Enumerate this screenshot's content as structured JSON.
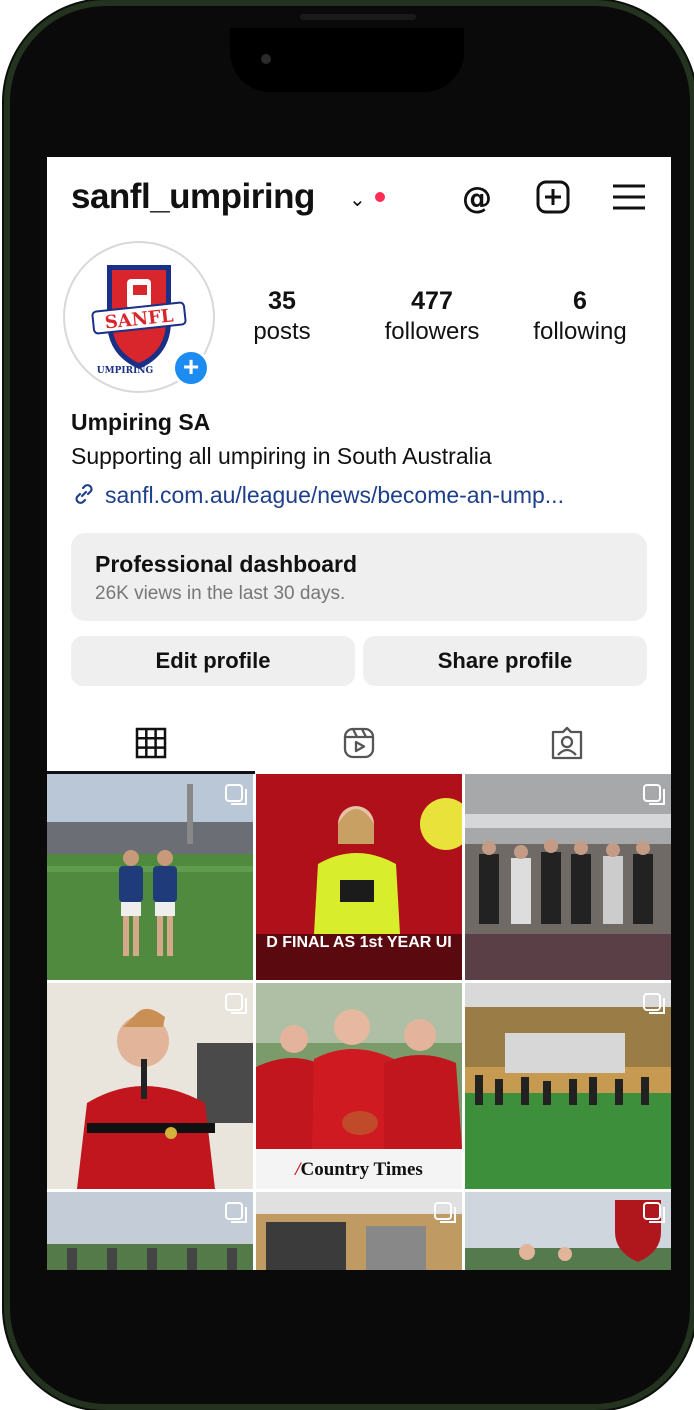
{
  "profile": {
    "username": "sanfl_umpiring",
    "display_name": "Umpiring SA",
    "bio": "Supporting all umpiring in South Australia",
    "link": "sanfl.com.au/league/news/become-an-ump...",
    "avatar_logo_text": "SANFL",
    "avatar_sub_text": "UMPIRING"
  },
  "stats": {
    "posts": {
      "value": "35",
      "label": "posts"
    },
    "followers": {
      "value": "477",
      "label": "followers"
    },
    "following": {
      "value": "6",
      "label": "following"
    }
  },
  "dashboard": {
    "title": "Professional dashboard",
    "subtitle": "26K views in the last 30 days."
  },
  "buttons": {
    "edit": "Edit profile",
    "share": "Share profile"
  },
  "tabs": [
    "grid-icon",
    "reels-icon",
    "tagged-icon"
  ],
  "posts": [
    {
      "id": "post-1",
      "caption": ""
    },
    {
      "id": "post-2",
      "caption": "D FINAL AS 1st YEAR UI"
    },
    {
      "id": "post-3",
      "caption": ""
    },
    {
      "id": "post-4",
      "caption": ""
    },
    {
      "id": "post-5",
      "caption": "Country Times"
    },
    {
      "id": "post-6",
      "caption": ""
    }
  ],
  "colors": {
    "accent_blue": "#1d8cf0",
    "notification_red": "#ff2d55",
    "link_blue": "#1e3f8a",
    "frame_green": "#23331f"
  }
}
